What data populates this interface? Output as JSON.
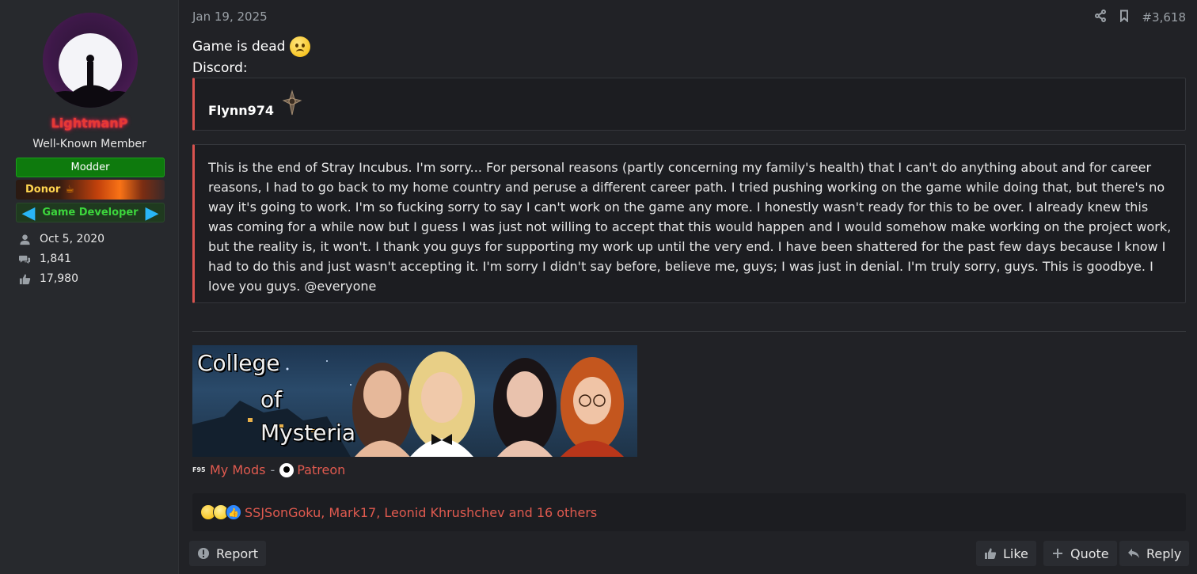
{
  "user": {
    "name": "LightmanP",
    "title": "Well-Known Member",
    "banners": {
      "modder": "Modder",
      "donor": "Donor",
      "dev": "Game Developer"
    },
    "stats": {
      "joined": "Oct 5, 2020",
      "messages": "1,841",
      "reactions": "17,980"
    }
  },
  "post": {
    "date": "Jan 19, 2025",
    "number": "#3,618",
    "line1": "Game is dead",
    "line2": "Discord:",
    "quote_author": "Flynn974",
    "quote_text": "This is the end of Stray Incubus. I'm sorry... For personal reasons (partly concerning my family's health) that I can't do anything about and for career reasons, I had to go back to my home country and peruse a different career path. I tried pushing working on the game while doing that, but there's no way it's going to work. I'm so fucking sorry to say I can't work on the game any more. I honestly wasn't ready for this to be over. I already knew this was coming for a while now but I guess I was just not willing to accept that this would happen and I would somehow make working on the project work, but the reality is, it won't. I thank you guys for supporting my work up until the very end. I have been shattered for the past few days because I know I had to do this and just wasn't accepting it. I'm sorry I didn't say before, believe me, guys; I was just in denial. I'm truly sorry, guys. This is goodbye. I love you guys. @everyone"
  },
  "signature": {
    "banner_words": [
      "College",
      "of",
      "Mysteria"
    ],
    "f95_logo": "F95",
    "link_mods": "My Mods",
    "separator": "-",
    "link_patreon": "Patreon"
  },
  "reactions": {
    "names": "SSJSonGoku, Mark17, Leonid Khrushchev and 16 others"
  },
  "actions": {
    "report": "Report",
    "like": "Like",
    "quote": "Quote",
    "reply": "Reply"
  },
  "colors": {
    "link": "#e05a4f",
    "username": "#e53935",
    "quote_border": "#d9534f"
  }
}
